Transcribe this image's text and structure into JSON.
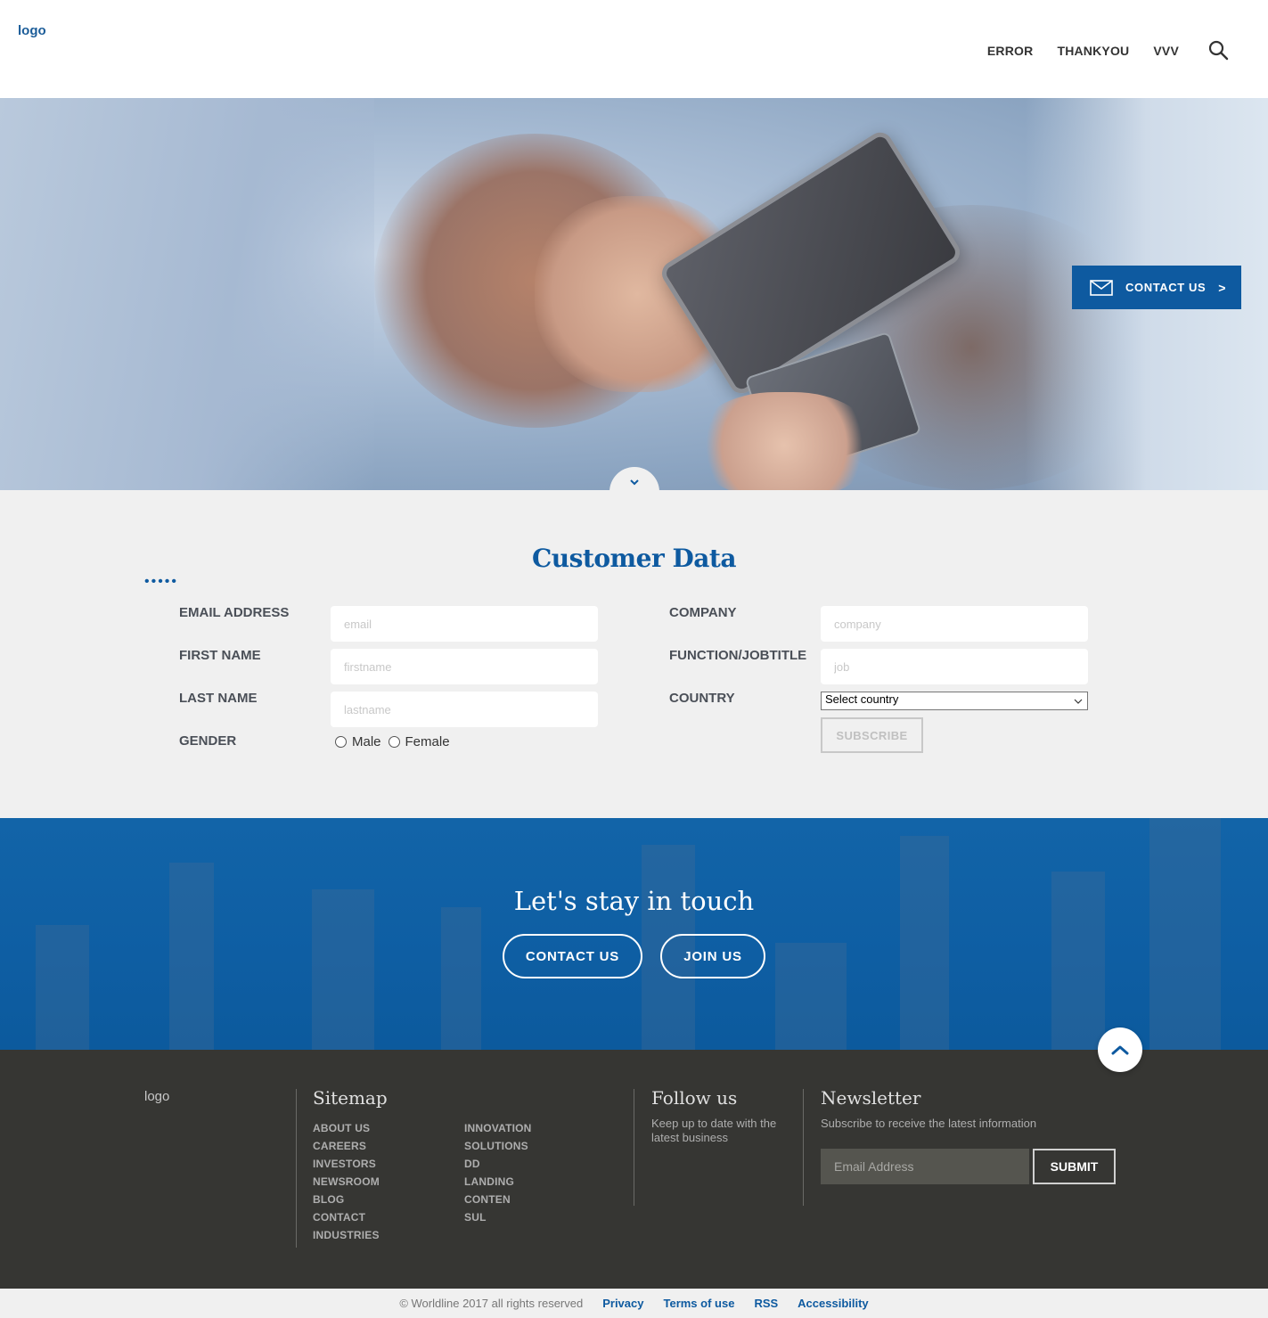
{
  "header": {
    "logo": "logo",
    "nav": [
      "ERROR",
      "THANKYOU",
      "VVV"
    ],
    "search_icon": "search-icon"
  },
  "hero": {
    "contact_label": "CONTACT US",
    "contact_chevron": ">",
    "mail_icon": "mail-icon",
    "scroll_icon": "chevron-down-icon"
  },
  "form": {
    "title": "Customer Data",
    "dots": "•••••",
    "email_label": "EMAIL ADDRESS",
    "email_placeholder": "email",
    "firstname_label": "FIRST NAME",
    "firstname_placeholder": "firstname",
    "lastname_label": "LAST NAME",
    "lastname_placeholder": "lastname",
    "gender_label": "GENDER",
    "gender_options": [
      "Male",
      "Female"
    ],
    "company_label": "COMPANY",
    "company_placeholder": "company",
    "job_label": "FUNCTION/JOBTITLE",
    "job_placeholder": "job",
    "country_label": "COUNTRY",
    "country_value": "Select country",
    "subscribe_label": "SUBSCRIBE"
  },
  "touch": {
    "title": "Let's stay in touch",
    "contact_label": "CONTACT US",
    "join_label": "JOIN US",
    "to_top_icon": "chevron-up-icon"
  },
  "footer": {
    "logo": "logo",
    "sitemap_title": "Sitemap",
    "sitemap_col1": [
      "ABOUT US",
      "CAREERS",
      "INVESTORS",
      "NEWSROOM",
      "BLOG",
      "CONTACT",
      "INDUSTRIES"
    ],
    "sitemap_col2": [
      "INNOVATION",
      "SOLUTIONS",
      "DD",
      "LANDING",
      "CONTEN",
      "SUL"
    ],
    "follow_title": "Follow us",
    "follow_text": "Keep up to date with the latest business",
    "newsletter_title": "Newsletter",
    "newsletter_text": "Subscribe to receive the latest information",
    "email_placeholder": "Email Address",
    "submit_label": "SUBMIT"
  },
  "bottom": {
    "copyright": "© Worldline 2017 all rights reserved",
    "links": [
      "Privacy",
      "Terms of use",
      "RSS",
      "Accessibility"
    ]
  },
  "colors": {
    "brand_blue": "#0e5aa0",
    "footer_bg": "#363633",
    "form_bg": "#f0f0f0"
  }
}
